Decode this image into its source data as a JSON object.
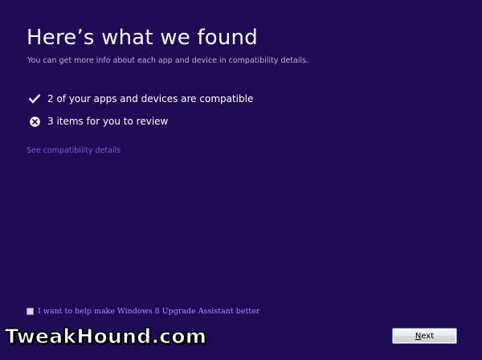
{
  "header": {
    "title": "Here’s what we found",
    "subtitle": "You can get more info about each app and device in compatibility details."
  },
  "results": [
    {
      "icon": "checkmark-icon",
      "text": "2 of your apps and devices are compatible"
    },
    {
      "icon": "x-circle-icon",
      "text": "3 items for you to review"
    }
  ],
  "links": {
    "details": "See compatibility details"
  },
  "feedback": {
    "label": "I want to help make Windows 8 Upgrade Assistant better",
    "checked": false
  },
  "footer": {
    "next_label": "Next",
    "watermark": "TweakHound.com"
  },
  "colors": {
    "background": "#1f0a55",
    "link": "#7b5fe0",
    "feedback_label": "#a68cff",
    "subtitle": "#b9b2d8"
  }
}
